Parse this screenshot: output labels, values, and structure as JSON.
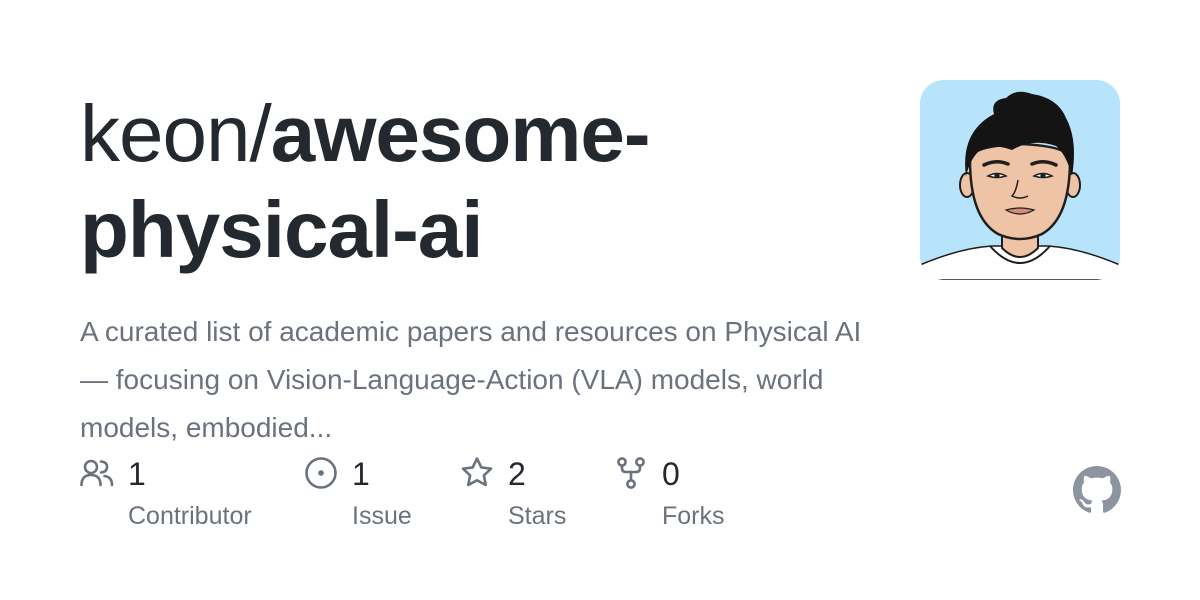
{
  "repo": {
    "owner": "keon/",
    "name": "awesome-physical-ai",
    "description": "A curated list of academic papers and resources on Physical AI — focusing on Vision-Language-Action (VLA) models, world models, embodied..."
  },
  "avatar": {
    "alt": "keon avatar",
    "background": "#b7e4fb"
  },
  "stats": [
    {
      "icon": "people-icon",
      "count": "1",
      "label": "Contributor"
    },
    {
      "icon": "issue-icon",
      "count": "1",
      "label": "Issue"
    },
    {
      "icon": "star-icon",
      "count": "2",
      "label": "Stars"
    },
    {
      "icon": "fork-icon",
      "count": "0",
      "label": "Forks"
    }
  ],
  "colors": {
    "title": "#24292f",
    "muted": "#6a737d",
    "icon": "#6a737d",
    "github_logo": "#8c959f"
  },
  "brand": {
    "icon": "github-logo-icon"
  }
}
